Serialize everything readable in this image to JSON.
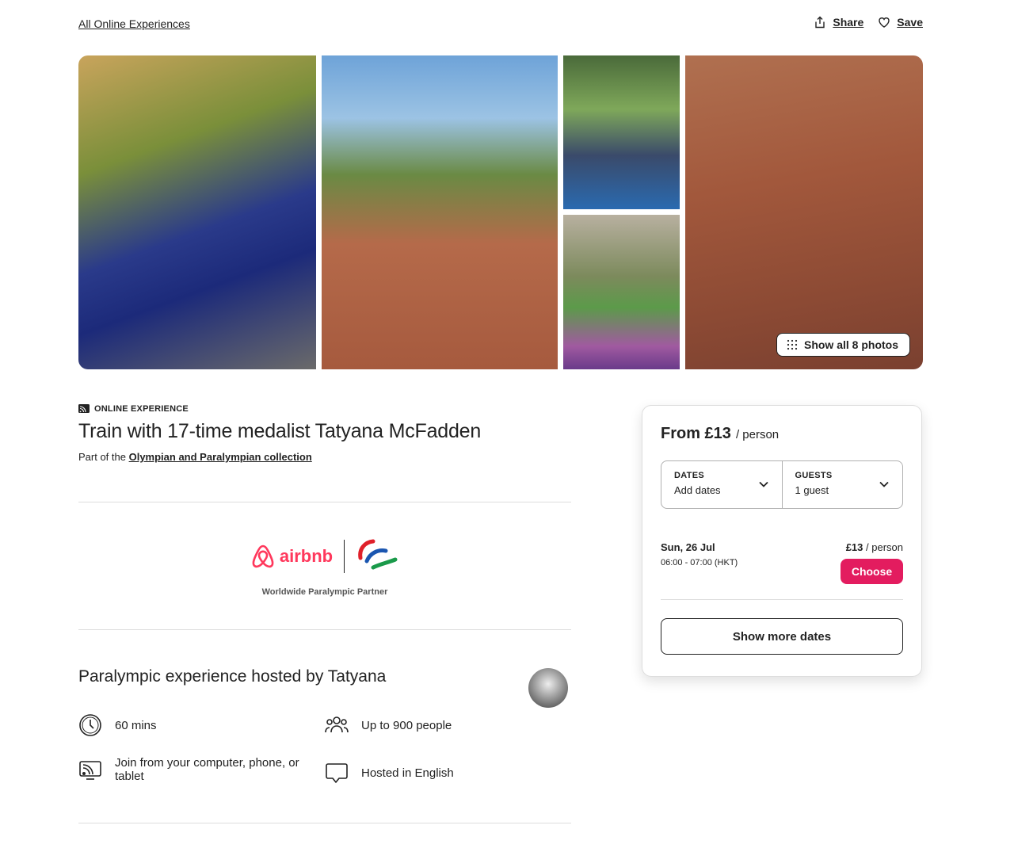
{
  "header": {
    "back_link": "All Online Experiences",
    "share_label": "Share",
    "save_label": "Save"
  },
  "gallery": {
    "show_all_label": "Show all 8 photos"
  },
  "listing": {
    "kicker": "ONLINE EXPERIENCE",
    "title": "Train with 17-time medalist Tatyana McFadden",
    "collection_prefix": "Part of the ",
    "collection_link": "Olympian and Paralympian collection"
  },
  "partner": {
    "brand": "airbnb",
    "caption": "Worldwide Paralympic Partner"
  },
  "host": {
    "title": "Paralympic experience hosted by Tatyana"
  },
  "features": [
    {
      "icon": "clock-icon",
      "label": "60 mins"
    },
    {
      "icon": "people-icon",
      "label": "Up to 900 people"
    },
    {
      "icon": "devices-icon",
      "label": "Join from your computer, phone, or tablet"
    },
    {
      "icon": "chat-bubble-icon",
      "label": "Hosted in English"
    }
  ],
  "booking": {
    "price": "From £13",
    "per": "/ person",
    "dates_label": "DATES",
    "dates_value": "Add dates",
    "guests_label": "GUESTS",
    "guests_value": "1 guest",
    "slot": {
      "date": "Sun, 26 Jul",
      "time": "06:00 - 07:00 (HKT)",
      "price": "£13",
      "per": "/ person",
      "button": "Choose"
    },
    "more_dates_label": "Show more dates"
  },
  "colors": {
    "brand": "#ff385c",
    "choose_button": "#e31c5f",
    "text": "#222222",
    "divider": "#dddddd"
  }
}
